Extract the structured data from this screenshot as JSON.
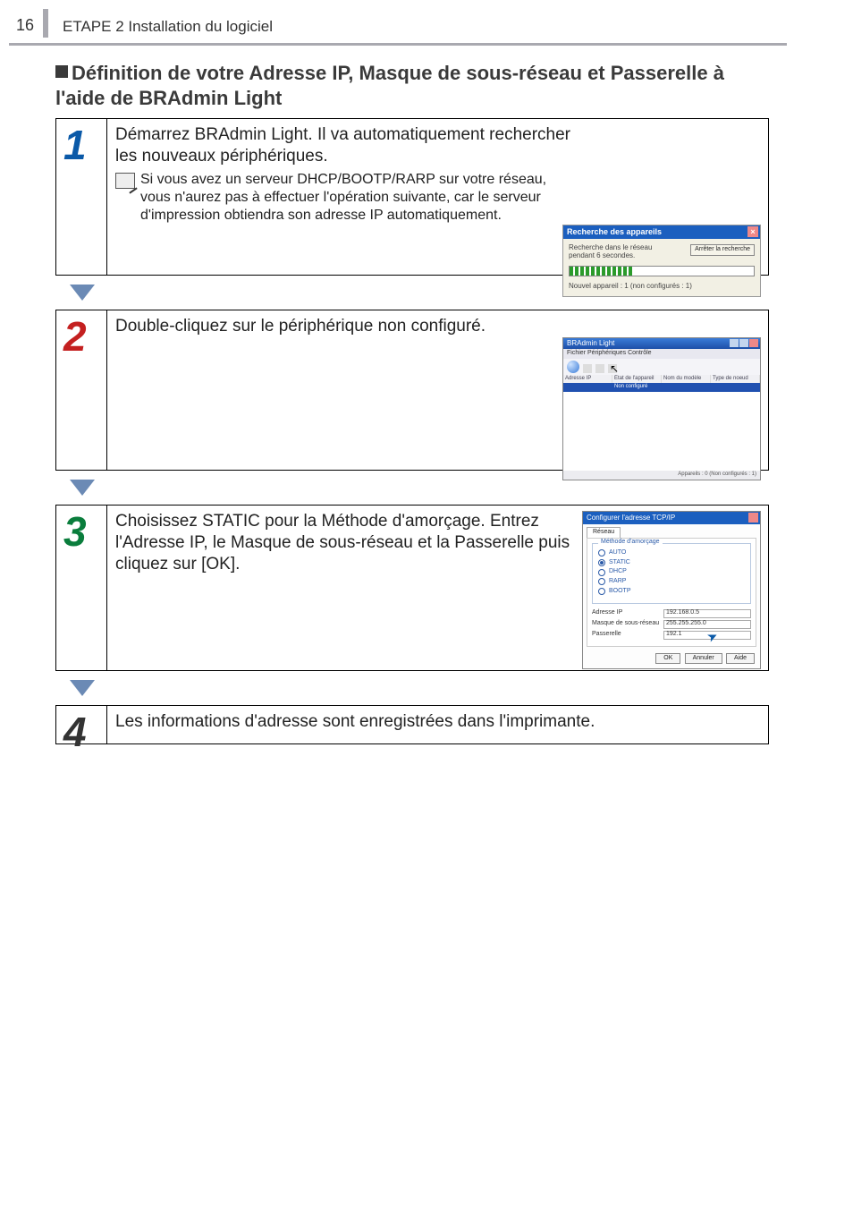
{
  "page_number": "16",
  "section_label": "ETAPE 2 Installation du logiciel",
  "subtitle": "Définition de votre Adresse IP, Masque de sous-réseau et Passerelle à l'aide de BRAdmin Light",
  "step1": {
    "text": "Démarrez BRAdmin Light. Il va automatiquement rechercher les nouveaux périphériques.",
    "note": "Si vous avez un serveur DHCP/BOOTP/RARP sur votre réseau, vous n'aurez pas à effectuer l'opération suivante, car le serveur d'impression obtiendra son adresse IP automatiquement.",
    "screenshot": {
      "title": "Recherche des appareils",
      "search_text": "Recherche dans le réseau pendant 6 secondes.",
      "stop_label": "Arrêter la recherche",
      "status": "Nouvel appareil : 1   (non configurés : 1)"
    }
  },
  "step2": {
    "text": "Double-cliquez sur le périphérique non configuré.",
    "screenshot": {
      "title": "BRAdmin Light",
      "menubar": "Fichier   Périphériques   Contrôle",
      "col1": "Adresse IP",
      "col2": "État de l'appareil",
      "col3": "Nom du modèle",
      "col4": "Type de noeud",
      "row1": "Non configuré",
      "statusbar": "Appareils : 0   (Non configurés : 1)"
    }
  },
  "step3": {
    "text": "Choisissez STATIC pour la Méthode d'amorçage. Entrez l'Adresse IP, le Masque de sous-réseau et la Passerelle puis cliquez sur [OK].",
    "screenshot": {
      "title": "Configurer l'adresse TCP/IP",
      "tab": "Réseau",
      "legend": "Méthode d'amorçage",
      "radio_auto": "AUTO",
      "radio_static": "STATIC",
      "radio_dhcp": "DHCP",
      "radio_rarp": "RARP",
      "radio_bootp": "BOOTP",
      "ip_label": "Adresse IP",
      "ip_value": "192.168.0.5",
      "mask_label": "Masque de sous-réseau",
      "mask_value": "255.255.255.0",
      "gw_label": "Passerelle",
      "gw_value": "192.1",
      "ok": "OK",
      "cancel": "Annuler",
      "help": "Aide"
    }
  },
  "step4": {
    "text": "Les informations d'adresse sont enregistrées dans l'imprimante."
  }
}
